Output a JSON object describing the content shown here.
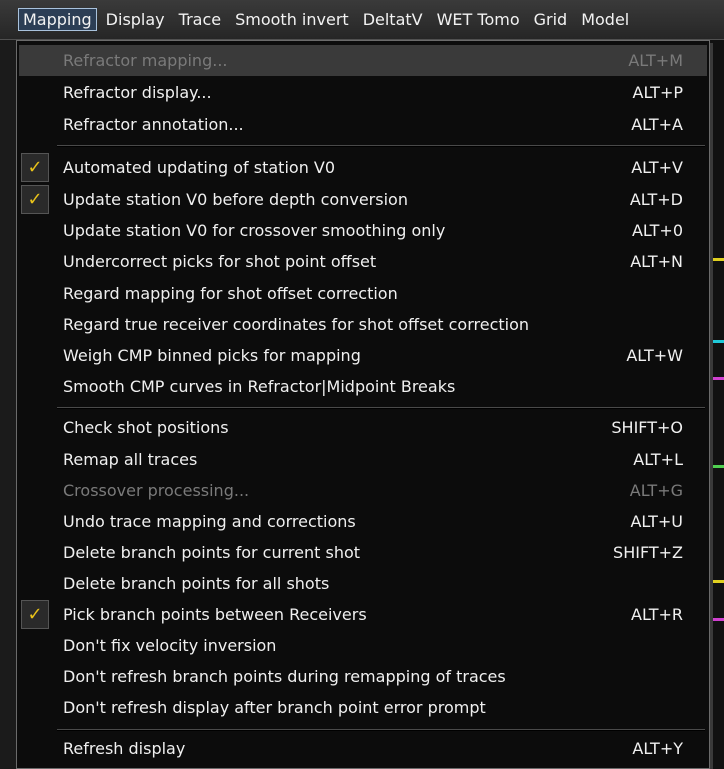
{
  "menubar": {
    "items": [
      {
        "label": "Mapping",
        "active": true
      },
      {
        "label": "Display",
        "active": false
      },
      {
        "label": "Trace",
        "active": false
      },
      {
        "label": "Smooth invert",
        "active": false
      },
      {
        "label": "DeltatV",
        "active": false
      },
      {
        "label": "WET Tomo",
        "active": false
      },
      {
        "label": "Grid",
        "active": false
      },
      {
        "label": "Model",
        "active": false
      }
    ]
  },
  "menu": {
    "items": [
      {
        "label": "Refractor mapping...",
        "shortcut": "ALT+M",
        "disabled": true,
        "checked": false,
        "highlight": true
      },
      {
        "label": "Refractor display...",
        "shortcut": "ALT+P",
        "disabled": false,
        "checked": false
      },
      {
        "label": "Refractor annotation...",
        "shortcut": "ALT+A",
        "disabled": false,
        "checked": false
      },
      {
        "label": "Automated updating of station V0",
        "shortcut": "ALT+V",
        "disabled": false,
        "checked": true
      },
      {
        "label": "Update station V0 before depth conversion",
        "shortcut": "ALT+D",
        "disabled": false,
        "checked": true
      },
      {
        "label": "Update station V0 for crossover smoothing only",
        "shortcut": "ALT+0",
        "disabled": false,
        "checked": false
      },
      {
        "label": "Undercorrect picks for shot point offset",
        "shortcut": "ALT+N",
        "disabled": false,
        "checked": false
      },
      {
        "label": "Regard mapping for shot offset correction",
        "shortcut": "",
        "disabled": false,
        "checked": false
      },
      {
        "label": "Regard true receiver coordinates for shot offset correction",
        "shortcut": "",
        "disabled": false,
        "checked": false
      },
      {
        "label": "Weigh CMP binned picks for mapping",
        "shortcut": "ALT+W",
        "disabled": false,
        "checked": false
      },
      {
        "label": "Smooth CMP curves in Refractor|Midpoint Breaks",
        "shortcut": "",
        "disabled": false,
        "checked": false
      },
      {
        "label": "Check shot positions",
        "shortcut": "SHIFT+O",
        "disabled": false,
        "checked": false
      },
      {
        "label": "Remap all traces",
        "shortcut": "ALT+L",
        "disabled": false,
        "checked": false
      },
      {
        "label": "Crossover processing...",
        "shortcut": "ALT+G",
        "disabled": true,
        "checked": false
      },
      {
        "label": "Undo trace mapping and corrections",
        "shortcut": "ALT+U",
        "disabled": false,
        "checked": false
      },
      {
        "label": "Delete branch points for current shot",
        "shortcut": "SHIFT+Z",
        "disabled": false,
        "checked": false
      },
      {
        "label": "Delete branch points for all shots",
        "shortcut": "",
        "disabled": false,
        "checked": false
      },
      {
        "label": "Pick branch points between Receivers",
        "shortcut": "ALT+R",
        "disabled": false,
        "checked": true
      },
      {
        "label": "Don't fix velocity inversion",
        "shortcut": "",
        "disabled": false,
        "checked": false
      },
      {
        "label": "Don't refresh branch points during remapping of traces",
        "shortcut": "",
        "disabled": false,
        "checked": false
      },
      {
        "label": "Don't refresh display after branch point error prompt",
        "shortcut": "",
        "disabled": false,
        "checked": false
      },
      {
        "label": "Refresh display",
        "shortcut": "ALT+Y",
        "disabled": false,
        "checked": false
      }
    ],
    "check_glyph": "✓",
    "check_color": "#e8c21a"
  }
}
